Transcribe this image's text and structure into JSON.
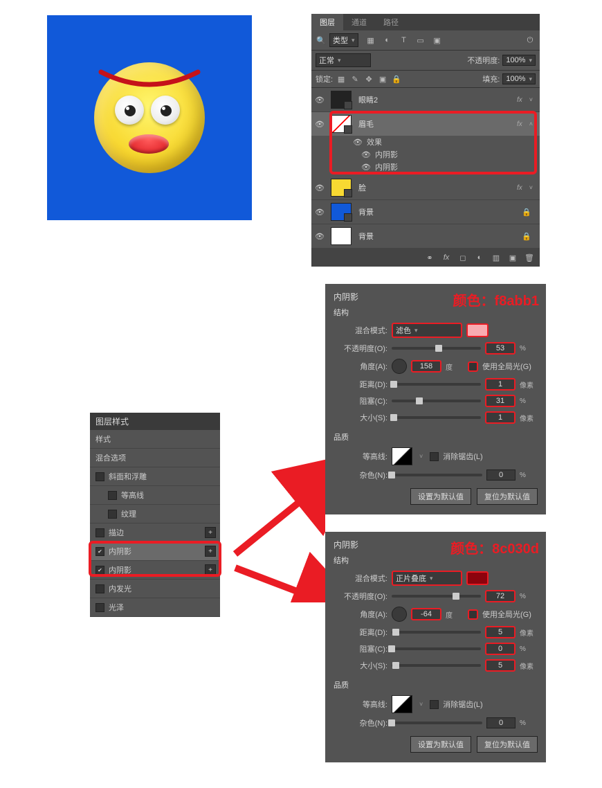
{
  "layers_panel": {
    "tabs": [
      "图层",
      "通道",
      "路径"
    ],
    "active_tab": 0,
    "filter_label": "类型",
    "blend_mode": "正常",
    "opacity_label": "不透明度:",
    "opacity_value": "100%",
    "lock_label": "锁定:",
    "fill_label": "填充:",
    "fill_value": "100%",
    "layers": [
      {
        "name": "眼睛2",
        "fx": true,
        "thumb": "#222"
      },
      {
        "name": "眉毛",
        "fx": true,
        "selected": true,
        "thumb": "#ffe"
      },
      {
        "name": "脸",
        "fx": true,
        "thumb": "#f8d932"
      },
      {
        "name": "背景",
        "lock": true,
        "thumb": "#1159d9"
      },
      {
        "name": "背景",
        "lock": true,
        "thumb": "#ffffff"
      }
    ],
    "effects_label": "效果",
    "effect_items": [
      "内阴影",
      "内阴影"
    ]
  },
  "styles_panel": {
    "title": "图层样式",
    "rows": [
      {
        "label": "样式",
        "type": "header"
      },
      {
        "label": "混合选项",
        "type": "header"
      },
      {
        "label": "斜面和浮雕",
        "check": false
      },
      {
        "label": "等高线",
        "check": false,
        "sub": true
      },
      {
        "label": "纹理",
        "check": false,
        "sub": true
      },
      {
        "label": "描边",
        "check": false,
        "plus": true
      },
      {
        "label": "内阴影",
        "check": true,
        "plus": true,
        "selected": true
      },
      {
        "label": "内阴影",
        "check": true,
        "plus": true
      },
      {
        "label": "内发光",
        "check": false
      },
      {
        "label": "光泽",
        "check": false
      }
    ]
  },
  "inner_shadow_1": {
    "title": "内阴影",
    "struct_label": "结构",
    "color_annot": "颜色：f8abb1",
    "color_hex": "#f8abb1",
    "blend_mode_label": "混合模式:",
    "blend_mode": "滤色",
    "opacity_label": "不透明度(O):",
    "opacity": "53",
    "angle_label": "角度(A):",
    "angle": "158",
    "angle_unit": "度",
    "global_light": "使用全局光(G)",
    "distance_label": "距离(D):",
    "distance": "1",
    "choke_label": "阻塞(C):",
    "choke": "31",
    "size_label": "大小(S):",
    "size": "1",
    "px": "像素",
    "pct": "%",
    "quality_label": "品质",
    "contour_label": "等高线:",
    "anti_alias": "消除锯齿(L)",
    "noise_label": "杂色(N):",
    "noise": "0",
    "btn_default": "设置为默认值",
    "btn_reset": "复位为默认值"
  },
  "inner_shadow_2": {
    "title": "内阴影",
    "struct_label": "结构",
    "color_annot": "颜色：8c030d",
    "color_hex": "#8c030d",
    "blend_mode_label": "混合模式:",
    "blend_mode": "正片叠底",
    "opacity_label": "不透明度(O):",
    "opacity": "72",
    "angle_label": "角度(A):",
    "angle": "-64",
    "angle_unit": "度",
    "global_light": "使用全局光(G)",
    "distance_label": "距离(D):",
    "distance": "5",
    "choke_label": "阻塞(C):",
    "choke": "0",
    "size_label": "大小(S):",
    "size": "5",
    "px": "像素",
    "pct": "%",
    "quality_label": "品质",
    "contour_label": "等高线:",
    "anti_alias": "消除锯齿(L)",
    "noise_label": "杂色(N):",
    "noise": "0",
    "btn_default": "设置为默认值",
    "btn_reset": "复位为默认值"
  }
}
